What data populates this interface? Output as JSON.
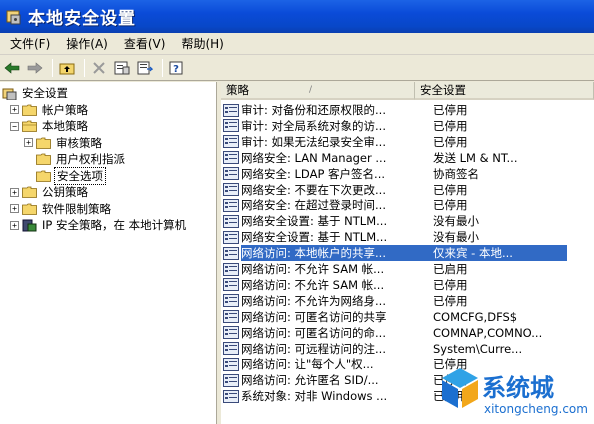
{
  "window": {
    "title": "本地安全设置"
  },
  "menu": [
    {
      "label": "文件(F)"
    },
    {
      "label": "操作(A)"
    },
    {
      "label": "查看(V)"
    },
    {
      "label": "帮助(H)"
    }
  ],
  "toolbar": {
    "buttons": [
      {
        "icon": "back-arrow-icon"
      },
      {
        "icon": "forward-arrow-icon"
      },
      {
        "icon": "up-folder-icon"
      },
      {
        "icon": "delete-icon"
      },
      {
        "icon": "properties-icon"
      },
      {
        "icon": "export-list-icon"
      },
      {
        "icon": "help-icon"
      }
    ]
  },
  "tree": [
    {
      "label": "安全设置",
      "level": 0,
      "expander": ""
    },
    {
      "label": "帐户策略",
      "level": 1,
      "expander": "+"
    },
    {
      "label": "本地策略",
      "level": 1,
      "expander": "-"
    },
    {
      "label": "审核策略",
      "level": 2,
      "expander": "+"
    },
    {
      "label": "用户权利指派",
      "level": 2,
      "expander": ""
    },
    {
      "label": "安全选项",
      "level": 2,
      "expander": "",
      "selected": true
    },
    {
      "label": "公钥策略",
      "level": 1,
      "expander": "+"
    },
    {
      "label": "软件限制策略",
      "level": 1,
      "expander": "+"
    },
    {
      "label": "IP 安全策略，在 本地计算机",
      "level": 1,
      "expander": "+"
    }
  ],
  "list": {
    "columns": [
      {
        "label": "策略",
        "sort": "/"
      },
      {
        "label": "安全设置"
      }
    ],
    "rows": [
      {
        "policy": "审计: 对备份和还原权限的...",
        "setting": "已停用"
      },
      {
        "policy": "审计: 对全局系统对象的访...",
        "setting": "已停用"
      },
      {
        "policy": "审计: 如果无法纪录安全审...",
        "setting": "已停用"
      },
      {
        "policy": "网络安全: LAN Manager ...",
        "setting": "发送 LM & NT..."
      },
      {
        "policy": "网络安全: LDAP 客户签名...",
        "setting": "协商签名"
      },
      {
        "policy": "网络安全: 不要在下次更改...",
        "setting": "已停用"
      },
      {
        "policy": "网络安全: 在超过登录时间...",
        "setting": "已停用"
      },
      {
        "policy": "网络安全设置: 基于 NTLM...",
        "setting": "没有最小"
      },
      {
        "policy": "网络安全设置: 基于 NTLM...",
        "setting": "没有最小"
      },
      {
        "policy": "网络访问: 本地帐户的共享...",
        "setting": "仅来宾 - 本地...",
        "selected": true
      },
      {
        "policy": "网络访问: 不允许 SAM 帐...",
        "setting": "已启用"
      },
      {
        "policy": "网络访问: 不允许 SAM 帐...",
        "setting": "已停用"
      },
      {
        "policy": "网络访问: 不允许为网络身...",
        "setting": "已停用"
      },
      {
        "policy": "网络访问: 可匿名访问的共享",
        "setting": "COMCFG,DFS$"
      },
      {
        "policy": "网络访问: 可匿名访问的命...",
        "setting": "COMNAP,COMNO..."
      },
      {
        "policy": "网络访问: 可远程访问的注...",
        "setting": "System\\Curre..."
      },
      {
        "policy": "网络访问: 让\"每个人\"权...",
        "setting": "已停用"
      },
      {
        "policy": "网络访问: 允许匿名 SID/...",
        "setting": "已停用"
      },
      {
        "policy": "系统对象: 对非 Windows ...",
        "setting": "已启用"
      }
    ]
  },
  "watermark": {
    "text": "系统城",
    "url": "xitongcheng.com"
  },
  "colors": {
    "titlebar": "#0a4bd8",
    "selection": "#316ac5",
    "face": "#ece9d8"
  }
}
